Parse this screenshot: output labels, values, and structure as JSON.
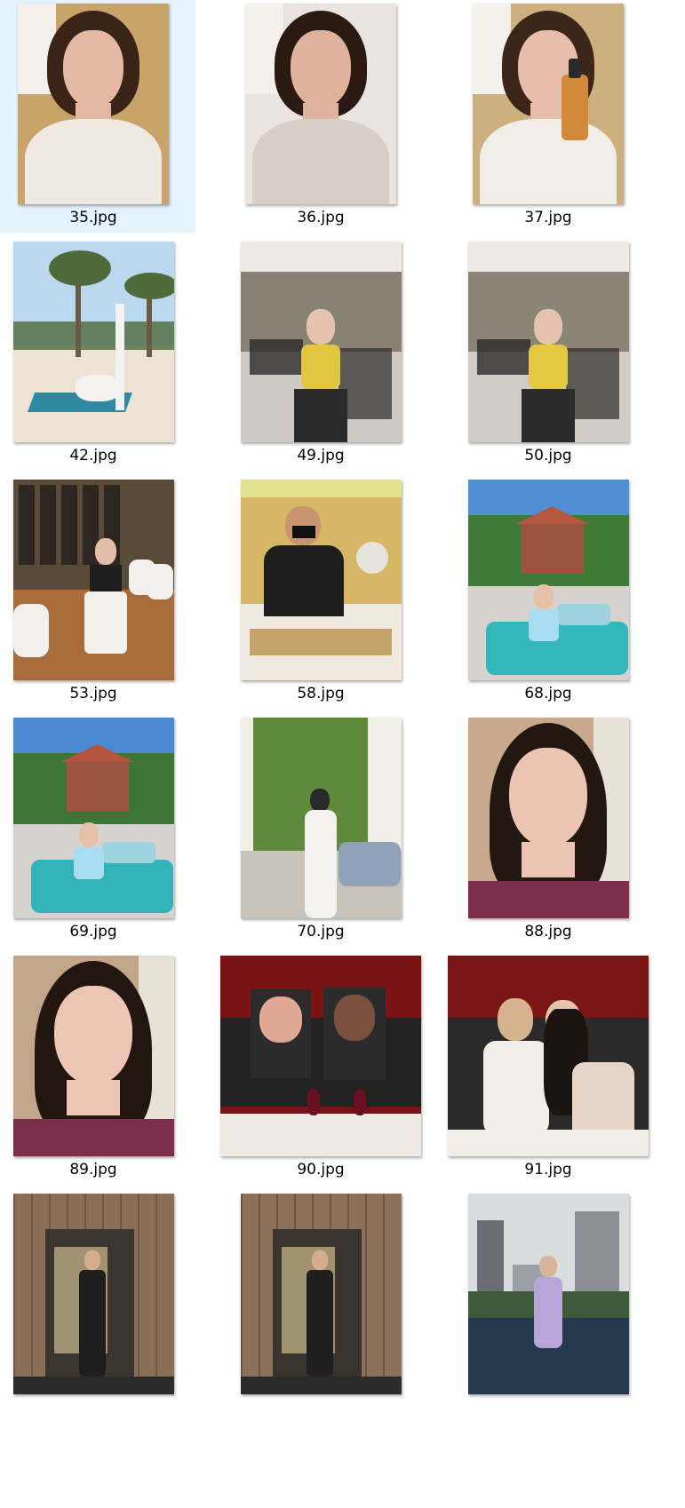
{
  "items": [
    {
      "label": "35.jpg",
      "selected": true,
      "thumb": {
        "w": 170,
        "h": 226
      },
      "scene": "selfie-white-top",
      "colors": {
        "bg": "#c8a46b",
        "top": "#efe9e2",
        "skin": "#e3b9a4",
        "hair": "#3a2418"
      }
    },
    {
      "label": "36.jpg",
      "selected": false,
      "thumb": {
        "w": 170,
        "h": 226
      },
      "scene": "selfie-grey-top",
      "colors": {
        "bg": "#e9e4df",
        "top": "#d8cfc8",
        "skin": "#dfb29d",
        "hair": "#2a1a12"
      }
    },
    {
      "label": "37.jpg",
      "selected": false,
      "thumb": {
        "w": 170,
        "h": 226
      },
      "scene": "selfie-bottle",
      "colors": {
        "bg": "#cdb07f",
        "top": "#f1ece6",
        "skin": "#e6bea9",
        "hair": "#3b2619"
      }
    },
    {
      "label": "42.jpg",
      "selected": false,
      "thumb": {
        "w": 181,
        "h": 226
      },
      "scene": "beach",
      "colors": {
        "sky": "#bcd8ef",
        "sand": "#ede3d5",
        "palm": "#4f6a3a",
        "dress": "#f4f2ef"
      }
    },
    {
      "label": "49.jpg",
      "selected": false,
      "thumb": {
        "w": 181,
        "h": 226
      },
      "scene": "cafe-yellow-top",
      "colors": {
        "bg": "#8a8175",
        "top": "#e2c640",
        "pants": "#2a2a2a",
        "floor": "#cfcac3"
      }
    },
    {
      "label": "50.jpg",
      "selected": false,
      "thumb": {
        "w": 181,
        "h": 226
      },
      "scene": "cafe-yellow-top",
      "colors": {
        "bg": "#8d8478",
        "top": "#e4c842",
        "pants": "#2a2a2a",
        "floor": "#d0cbc4"
      }
    },
    {
      "label": "53.jpg",
      "selected": false,
      "thumb": {
        "w": 181,
        "h": 226
      },
      "scene": "bar-interior",
      "colors": {
        "bg": "#5a4a38",
        "floor": "#a86b3a",
        "chair": "#f2f0ec",
        "top": "#1f1f1f"
      }
    },
    {
      "label": "58.jpg",
      "selected": false,
      "thumb": {
        "w": 181,
        "h": 226
      },
      "scene": "chef",
      "colors": {
        "bg": "#d6b766",
        "counter": "#efe9df",
        "chef": "#1f1f1f",
        "skin": "#c9946f"
      }
    },
    {
      "label": "68.jpg",
      "selected": false,
      "thumb": {
        "w": 181,
        "h": 226
      },
      "scene": "resort-sofa",
      "colors": {
        "sky": "#4f8fd6",
        "trees": "#3f7a36",
        "roof": "#b5583f",
        "sofa": "#33b7bd"
      }
    },
    {
      "label": "69.jpg",
      "selected": false,
      "thumb": {
        "w": 181,
        "h": 226
      },
      "scene": "resort-sofa",
      "colors": {
        "sky": "#4b8ad3",
        "trees": "#3d7634",
        "roof": "#b4563e",
        "sofa": "#31b3b9"
      }
    },
    {
      "label": "70.jpg",
      "selected": false,
      "thumb": {
        "w": 181,
        "h": 226
      },
      "scene": "garden-white-dress",
      "colors": {
        "bg": "#5f8a3c",
        "curtain": "#f2efe9",
        "dress": "#f4f2ee",
        "sofa": "#8fa2b8"
      }
    },
    {
      "label": "88.jpg",
      "selected": false,
      "thumb": {
        "w": 181,
        "h": 226
      },
      "scene": "portrait-dark-hair",
      "colors": {
        "bg": "#c8a98e",
        "skin": "#ebc4b4",
        "hair": "#231811",
        "top": "#7b2f4a"
      }
    },
    {
      "label": "89.jpg",
      "selected": false,
      "thumb": {
        "w": 181,
        "h": 226
      },
      "scene": "portrait-dark-hair",
      "colors": {
        "bg": "#c3a58a",
        "skin": "#ecc5b5",
        "hair": "#211610",
        "top": "#7a2e49"
      }
    },
    {
      "label": "90.jpg",
      "selected": false,
      "thumb": {
        "w": 226,
        "h": 226
      },
      "scene": "pig-masks",
      "colors": {
        "bg": "#7a1414",
        "mask": "#e0a792",
        "suit": "#2b2b2b",
        "table": "#eeeae3"
      }
    },
    {
      "label": "91.jpg",
      "selected": false,
      "thumb": {
        "w": 226,
        "h": 226
      },
      "scene": "two-women-dinner",
      "colors": {
        "bg": "#7a1616",
        "dark": "#2a2a2a",
        "top": "#f1eeea",
        "skin": "#e6c2ad"
      }
    },
    {
      "label": "",
      "selected": false,
      "thumb": {
        "w": 181,
        "h": 226
      },
      "scene": "wooden-door",
      "colors": {
        "wood": "#8a6e55",
        "dark": "#3b3530",
        "outfit": "#1e1e1e",
        "light": "#e9d49c"
      }
    },
    {
      "label": "",
      "selected": false,
      "thumb": {
        "w": 181,
        "h": 226
      },
      "scene": "wooden-door",
      "colors": {
        "wood": "#8c705a",
        "dark": "#3a342f",
        "outfit": "#1f1f1f",
        "light": "#e8d39b"
      }
    },
    {
      "label": "",
      "selected": false,
      "thumb": {
        "w": 181,
        "h": 226
      },
      "scene": "pool-city",
      "colors": {
        "sky": "#d9dde0",
        "building": "#8a8e94",
        "water": "#26384c",
        "suit": "#b8a6d8"
      }
    }
  ]
}
